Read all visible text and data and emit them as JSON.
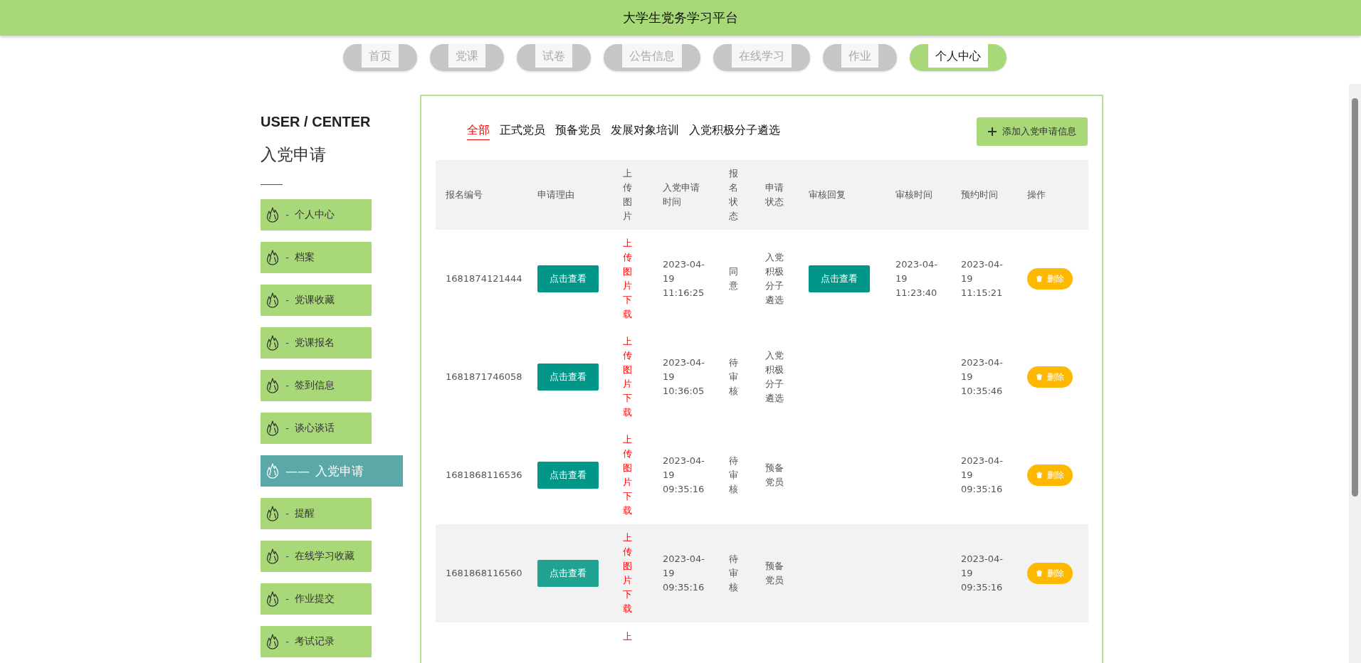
{
  "header": {
    "title": "大学生党务学习平台"
  },
  "nav": [
    {
      "label": "首页",
      "selected": false
    },
    {
      "label": "党课",
      "selected": false
    },
    {
      "label": "试卷",
      "selected": false
    },
    {
      "label": "公告信息",
      "selected": false
    },
    {
      "label": "在线学习",
      "selected": false
    },
    {
      "label": "作业",
      "selected": false
    },
    {
      "label": "个人中心",
      "selected": true
    }
  ],
  "sidebar": {
    "heading": "USER / CENTER",
    "title": "入党申请",
    "items": [
      {
        "prefix": "-",
        "label": "个人中心",
        "selected": false
      },
      {
        "prefix": "-",
        "label": "档案",
        "selected": false
      },
      {
        "prefix": "-",
        "label": "党课收藏",
        "selected": false
      },
      {
        "prefix": "-",
        "label": "党课报名",
        "selected": false
      },
      {
        "prefix": "-",
        "label": "签到信息",
        "selected": false
      },
      {
        "prefix": "-",
        "label": "谈心谈话",
        "selected": false
      },
      {
        "prefix": "——",
        "label": "入党申请",
        "selected": true
      },
      {
        "prefix": "-",
        "label": "提醒",
        "selected": false
      },
      {
        "prefix": "-",
        "label": "在线学习收藏",
        "selected": false
      },
      {
        "prefix": "-",
        "label": "作业提交",
        "selected": false
      },
      {
        "prefix": "-",
        "label": "考试记录",
        "selected": false
      }
    ]
  },
  "filters": [
    {
      "label": "全部",
      "selected": true
    },
    {
      "label": "正式党员",
      "selected": false
    },
    {
      "label": "预备党员",
      "selected": false
    },
    {
      "label": "发展对象培训",
      "selected": false
    },
    {
      "label": "入党积极分子遴选",
      "selected": false
    }
  ],
  "add_button": "添加入党申请信息",
  "table": {
    "columns": [
      "报名编号",
      "申请理由",
      "上传图片",
      "入党申请时间",
      "报名状态",
      "申请状态",
      "审核回复",
      "审核时间",
      "预约时间",
      "操作"
    ],
    "rows": [
      {
        "highlighted": false,
        "id": "1681874121444",
        "reason": "点击查看",
        "upload": "上传图片下载",
        "apply_time": "2023-04-19 11:16:25",
        "reg_status": "同意",
        "apply_status": "入党积极分子遴选",
        "reply": "点击查看",
        "review_time": "2023-04-19 11:23:40",
        "appointment_time": "2023-04-19 11:15:21",
        "action": "删除"
      },
      {
        "highlighted": false,
        "id": "1681871746058",
        "reason": "点击查看",
        "upload": "上传图片下载",
        "apply_time": "2023-04-19 10:36:05",
        "reg_status": "待审核",
        "apply_status": "入党积极分子遴选",
        "appointment_time": "2023-04-19 10:35:46",
        "action": "删除"
      },
      {
        "highlighted": false,
        "id": "1681868116536",
        "reason": "点击查看",
        "upload": "上传图片下载",
        "apply_time": "2023-04-19 09:35:16",
        "reg_status": "待审核",
        "apply_status": "预备党员",
        "appointment_time": "2023-04-19 09:35:16",
        "action": "删除"
      },
      {
        "highlighted": true,
        "id": "1681868116560",
        "reason": "点击查看",
        "upload": "上传图片下载",
        "apply_time": "2023-04-19 09:35:16",
        "reg_status": "待审核",
        "apply_status": "预备党员",
        "appointment_time": "2023-04-19 09:35:16",
        "action": "删除"
      },
      {
        "upload": "上"
      }
    ]
  }
}
